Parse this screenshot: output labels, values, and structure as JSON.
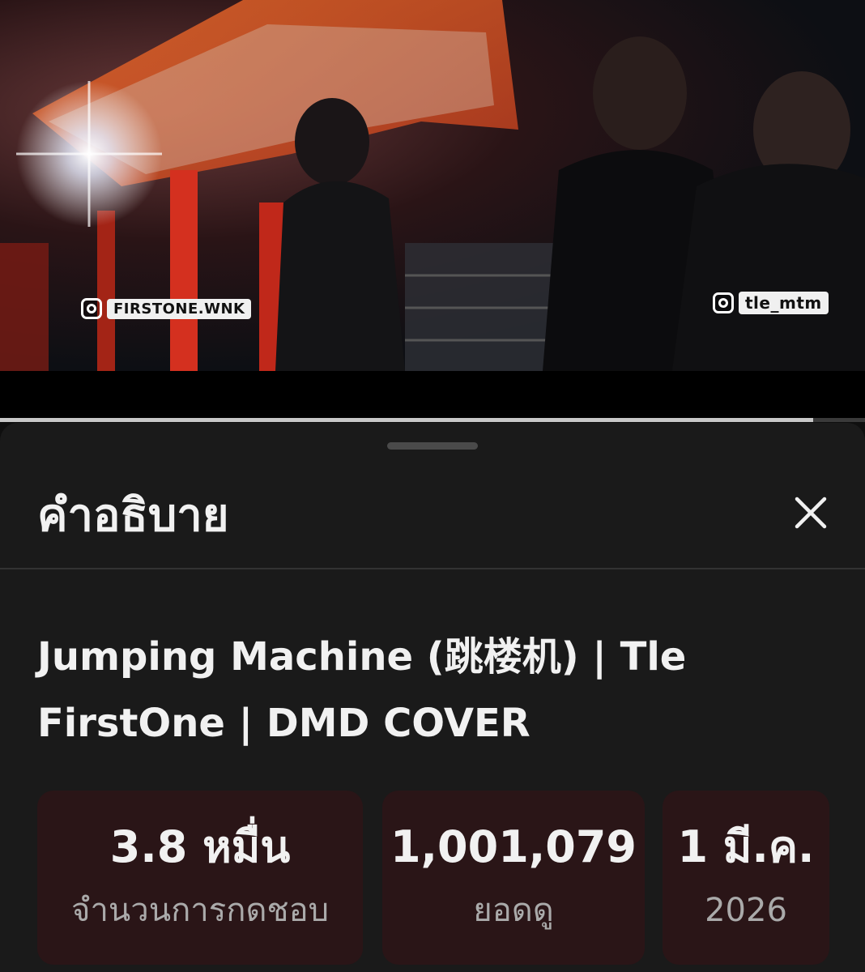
{
  "video": {
    "watermark_left": "FIRSTONE.WNK",
    "watermark_right": "tle_mtm",
    "progress": 0.94
  },
  "sheet": {
    "title": "คำอธิบาย",
    "close_icon": "close-icon",
    "video_title": "Jumping Machine (跳楼机) | Tle FirstOne | DMD COVER"
  },
  "stats": [
    {
      "value": "3.8 หมื่น",
      "label": "จำนวนการกดชอบ"
    },
    {
      "value": "1,001,079",
      "label": "ยอดดู"
    },
    {
      "value": "1 มี.ค.",
      "label": "2026"
    }
  ],
  "colors": {
    "background": "#0f0f0f",
    "sheet": "#1a1a1a",
    "stat_card": "#2a1517",
    "text_primary": "#f1f1f1",
    "text_secondary": "#aaaaaa"
  }
}
